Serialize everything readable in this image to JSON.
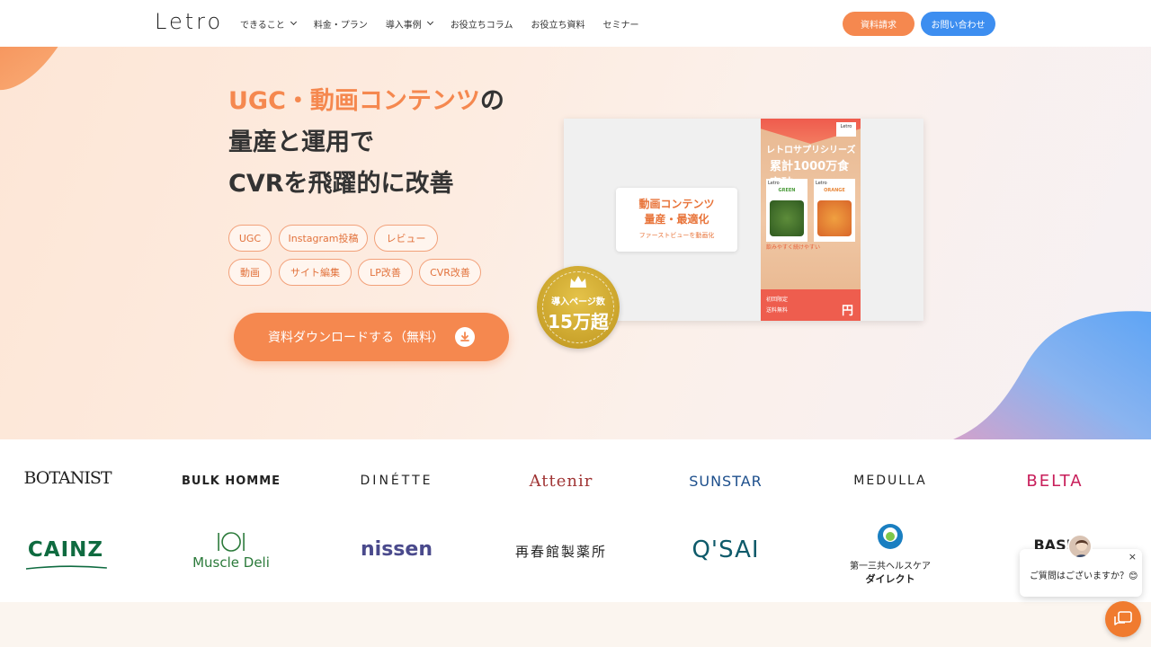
{
  "header": {
    "logo": "Letro",
    "nav": [
      {
        "label": "できること",
        "dropdown": true
      },
      {
        "label": "料金・プラン",
        "dropdown": false
      },
      {
        "label": "導入事例",
        "dropdown": true
      },
      {
        "label": "お役立ちコラム",
        "dropdown": false
      },
      {
        "label": "お役立ち資料",
        "dropdown": false
      },
      {
        "label": "セミナー",
        "dropdown": false
      }
    ],
    "doc_button": "資料請求",
    "contact_button": "お問い合わせ"
  },
  "hero": {
    "headline_accent": "UGC・動画コンテンツ",
    "headline_line1_suffix": "の",
    "headline_line2": "量産と運用で",
    "headline_line3": "CVRを飛躍的に改善",
    "tags": [
      "UGC",
      "Instagram投稿",
      "レビュー",
      "動画",
      "サイト編集",
      "LP改善",
      "CVR改善"
    ],
    "cta_label": "資料ダウンロードする（無料）",
    "mock": {
      "card_title_1": "動画コンテンツ",
      "card_title_2": "量産・最適化",
      "card_sub": "ファーストビューを動画化",
      "phone_logo": "Letro",
      "phone_text_1": "レトロサプリシリーズ",
      "phone_text_2": "累計1000万食突破",
      "bottle_left_label": "GREEN",
      "bottle_right_label": "ORANGE",
      "phone_note": "飲みやすく続けやすい",
      "phone_bottom_1": "初回限定",
      "phone_bottom_2": "送料無料",
      "phone_yen": "円"
    },
    "badge_line1": "導入ページ数",
    "badge_line2": "15万超"
  },
  "logos": [
    "BOTANIST",
    "BULK HOMME",
    "DINÉTTE",
    "Attenir",
    "SUNSTAR",
    "MEDULLA",
    "BELTA",
    "CAINZ",
    "Muscle Deli",
    "nissen",
    "再春館製薬所",
    "Q'SAI",
    "第一三共ヘルスケア",
    "ダイレクト",
    "BASE"
  ],
  "chat": {
    "message": "ご質問はございますか？😊",
    "close": "×"
  },
  "colors": {
    "accent": "#f5884f",
    "blue": "#3d8ef0",
    "fab": "#f07b2f"
  }
}
